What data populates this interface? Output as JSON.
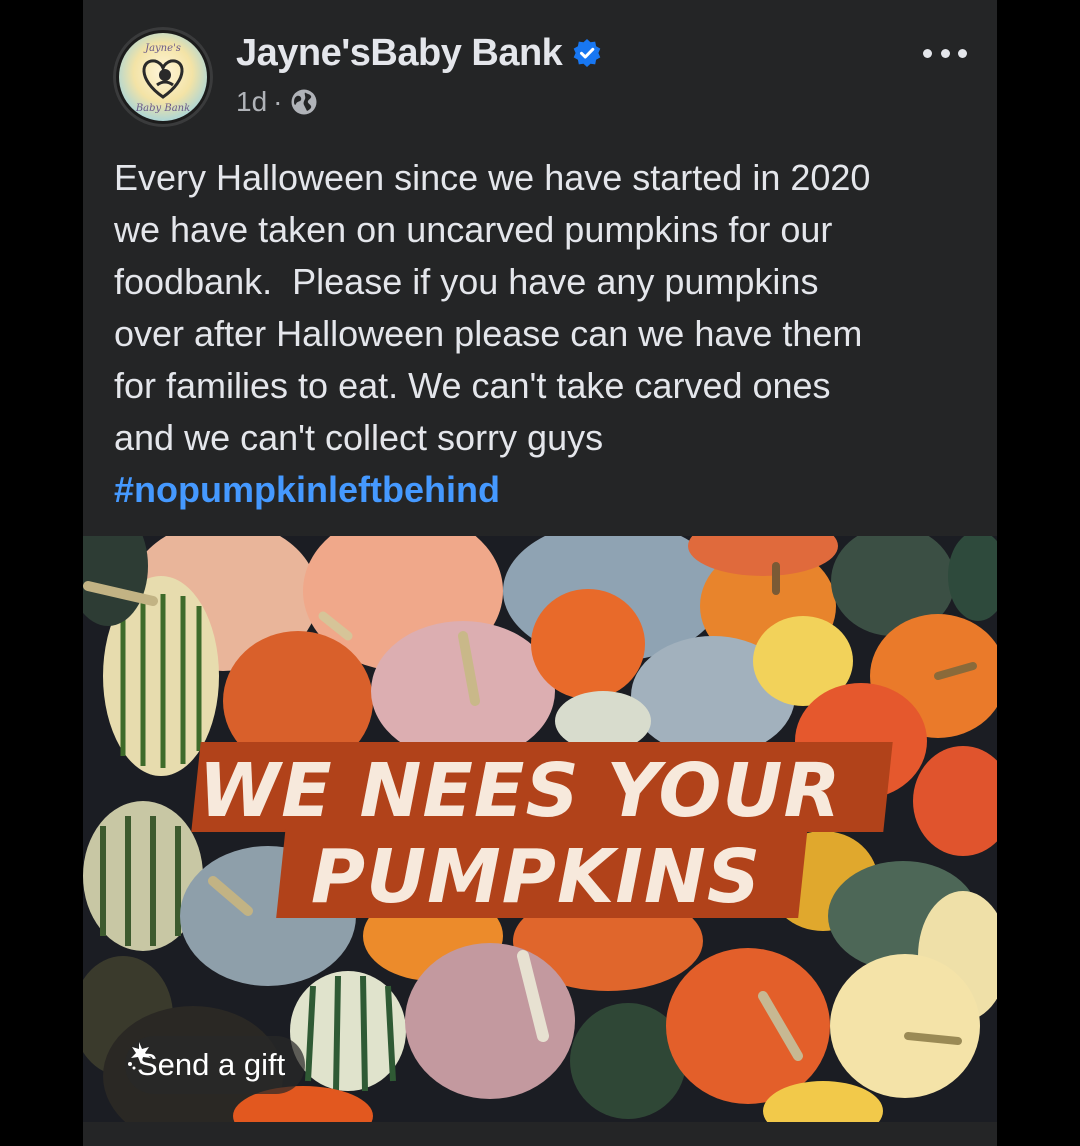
{
  "post": {
    "page_name": "Jayne'sBaby Bank",
    "verified": true,
    "timestamp": "1d",
    "separator": "·",
    "audience_icon": "globe-icon",
    "body_text": "Every Halloween since we have started in 2020\nwe have taken on uncarved pumpkins for our\nfoodbank.  Please if you have any pumpkins\nover after Halloween please can we have them\nfor families to eat. We can't take carved ones\nand we can't collect sorry guys",
    "hashtag": "#nopumpkinleftbehind",
    "avatar_text": {
      "top": "Jayne's",
      "bottom": "Baby Bank"
    }
  },
  "image": {
    "banner_line1": "WE NEES YOUR",
    "banner_line2": "PUMPKINS",
    "banner_color": "#b1421a"
  },
  "actions": {
    "send_gift_label": "Send a gift",
    "more_icon": "more-dots-icon"
  },
  "colors": {
    "background": "#000000",
    "card": "#242526",
    "text": "#e4e6eb",
    "secondary_text": "#b0b3b8",
    "link": "#4599ff",
    "verified": "#1877f2"
  }
}
